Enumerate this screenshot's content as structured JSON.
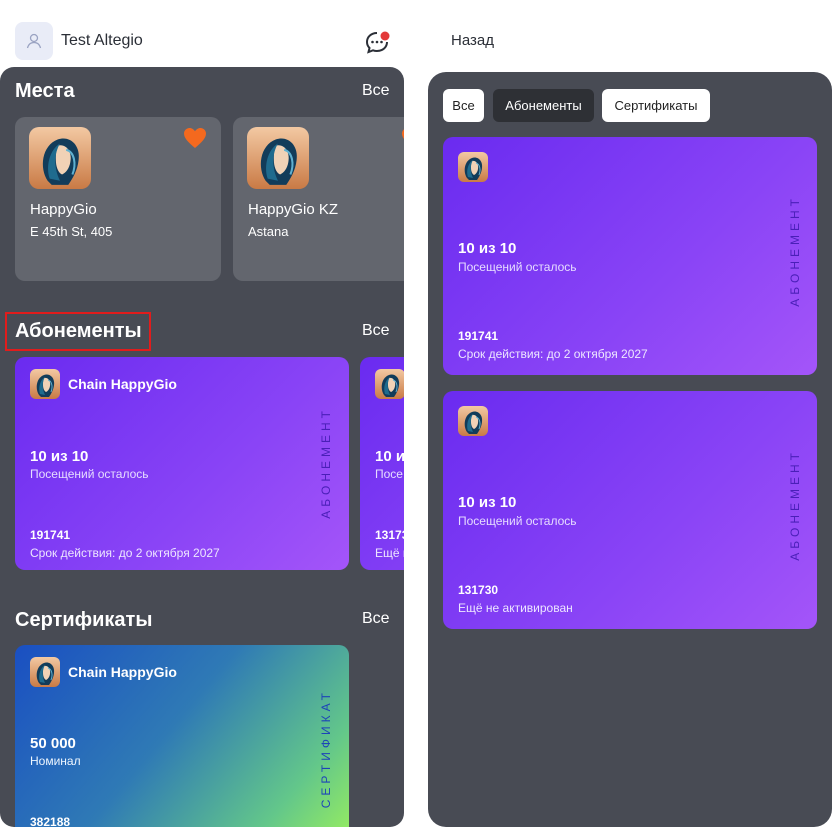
{
  "left": {
    "user_name": "Test Altegio",
    "places": {
      "title": "Места",
      "all_label": "Все",
      "items": [
        {
          "name": "HappyGio",
          "address": "E 45th St, 405"
        },
        {
          "name": "HappyGio KZ",
          "address": "Astana"
        }
      ]
    },
    "subscriptions": {
      "title": "Абонементы",
      "all_label": "Все",
      "cards": [
        {
          "chain": "Chain HappyGio",
          "visits": "10 из 10",
          "visits_label": "Посещений осталось",
          "number": "191741",
          "validity": "Срок действия: до 2 октября 2027",
          "type_label": "АБОНЕМЕНТ"
        },
        {
          "chain": "",
          "visits": "10 из",
          "visits_label": "Посе",
          "number": "13173",
          "validity": "Ещё н",
          "type_label": ""
        }
      ]
    },
    "certificates": {
      "title": "Сертификаты",
      "all_label": "Все",
      "card": {
        "chain": "Chain HappyGio",
        "amount": "50 000",
        "amount_label": "Номинал",
        "number": "382188",
        "type_label": "СЕРТИФИКАТ"
      }
    }
  },
  "right": {
    "back_label": "Назад",
    "tabs": [
      {
        "label": "Все",
        "active": false
      },
      {
        "label": "Абонементы",
        "active": true
      },
      {
        "label": "Сертификаты",
        "active": false
      }
    ],
    "cards": [
      {
        "visits": "10 из 10",
        "visits_label": "Посещений осталось",
        "number": "191741",
        "status": "Срок действия: до 2 октября 2027",
        "type_label": "АБОНЕМЕНТ"
      },
      {
        "visits": "10 из 10",
        "visits_label": "Посещений осталось",
        "number": "131730",
        "status": "Ещё не активирован",
        "type_label": "АБОНЕМЕНТ"
      }
    ]
  },
  "colors": {
    "screen_bg": "#484b54",
    "card_purple": "#7b3cf4",
    "heart": "#f4691e",
    "highlight": "#e11c1c"
  }
}
